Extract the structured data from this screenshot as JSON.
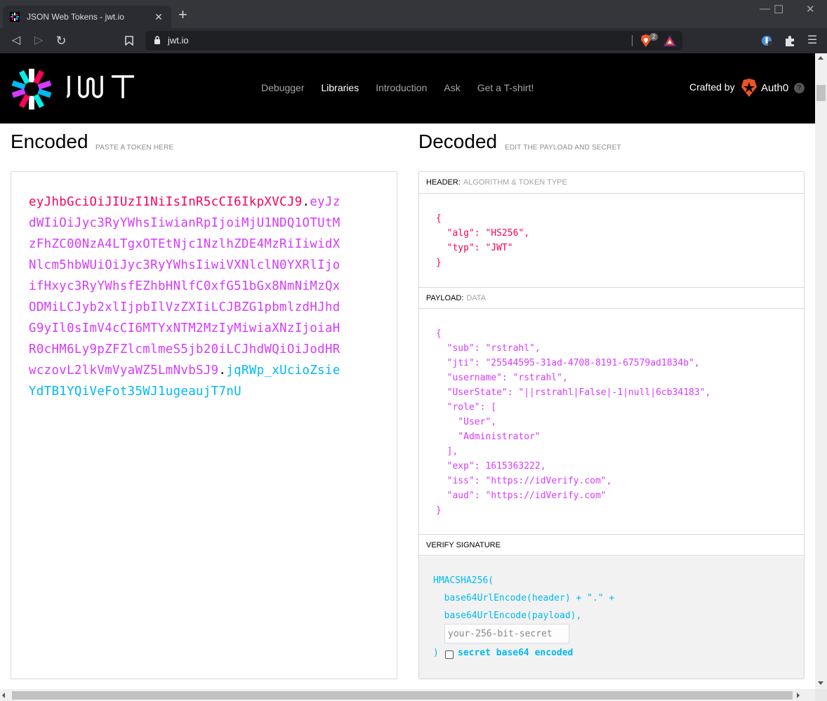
{
  "browser": {
    "tab_title": "JSON Web Tokens - jwt.io",
    "url": "jwt.io",
    "brave_shield_count": "2",
    "new_tab_symbol": "+",
    "close_symbol": "✕",
    "minimize_symbol": "—",
    "maximize_symbol": "☐",
    "window_close_symbol": "✕",
    "back_symbol": "◁",
    "forward_symbol": "▷",
    "reload_symbol": "↻",
    "menu_symbol": "☰"
  },
  "header": {
    "logo_text": "JWT",
    "nav": [
      {
        "label": "Debugger",
        "active": false
      },
      {
        "label": "Libraries",
        "active": true
      },
      {
        "label": "Introduction",
        "active": false
      },
      {
        "label": "Ask",
        "active": false
      },
      {
        "label": "Get a T-shirt!",
        "active": false
      }
    ],
    "crafted_by": "Crafted by",
    "brand": "Auth0",
    "help": "?"
  },
  "encoded": {
    "title": "Encoded",
    "subtitle": "PASTE A TOKEN HERE",
    "token_header": "eyJhbGciOiJIUzI1NiIsInR5cCI6IkpXVCJ9",
    "token_payload": "eyJzdWIiOiJyc3RyYWhsIiwianRpIjoiMjU1NDQ1OTUtMzFhZC00NzA4LTgxOTEtNjc1NzlhZDE4MzRiIiwidXNlcm5hbWUiOiJyc3RyYWhsIiwiVXNlclN0YXRlIjoifHxyc3RyYWhsfEZhbHNlfC0xfG51bGx8NmNiMzQxODMiLCJyb2xlIjpbIlVzZXIiLCJBZG1pbmlzdHJhdG9yIl0sImV4cCI6MTYxNTM2MzIyMiwiaXNzIjoiaHR0cHM6Ly9pZFZlcmlmeS5jb20iLCJhdWQiOiJodHRwczovL2lkVmVyaWZ5LmNvbSJ9",
    "token_signature": "jqRWp_xUcioZsieYdTB1YQiVeFot35WJ1ugeaujT7nU",
    "dot": "."
  },
  "decoded": {
    "title": "Decoded",
    "subtitle": "EDIT THE PAYLOAD AND SECRET",
    "header_panel": {
      "label": "HEADER:",
      "sublabel": "ALGORITHM & TOKEN TYPE",
      "json": "{\n  \"alg\": \"HS256\",\n  \"typ\": \"JWT\"\n}"
    },
    "payload_panel": {
      "label": "PAYLOAD:",
      "sublabel": "DATA",
      "json": "{\n  \"sub\": \"rstrahl\",\n  \"jti\": \"25544595-31ad-4708-8191-67579ad1834b\",\n  \"username\": \"rstrahl\",\n  \"UserState\": \"||rstrahl|False|-1|null|6cb34183\",\n  \"role\": [\n    \"User\",\n    \"Administrator\"\n  ],\n  \"exp\": 1615363222,\n  \"iss\": \"https://idVerify.com\",\n  \"aud\": \"https://idVerify.com\"\n}"
    },
    "signature_panel": {
      "label": "VERIFY SIGNATURE",
      "code": "HMACSHA256(\n  base64UrlEncode(header) + \".\" +\n  base64UrlEncode(payload),",
      "secret_placeholder": "your-256-bit-secret",
      "secret_value": "",
      "close_paren": ")",
      "base64_label": "secret base64 encoded",
      "base64_checked": false
    }
  },
  "colors": {
    "header_token": "#fb015b",
    "payload_token": "#d63aff",
    "signature_token": "#00b9f1"
  }
}
